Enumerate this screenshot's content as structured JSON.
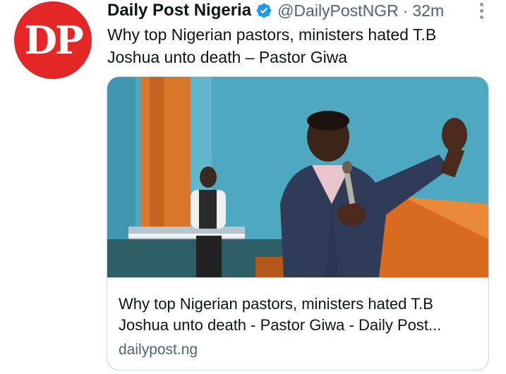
{
  "tweet": {
    "avatar_text": "DP",
    "display_name": "Daily Post Nigeria",
    "handle": "@DailyPostNGR",
    "separator": "·",
    "time": "32m",
    "text": "Why top Nigerian pastors, ministers hated T.B Joshua unto death – Pastor Giwa",
    "verified_icon": "verified-badge-icon",
    "more_icon": "more-vertical-icon"
  },
  "card": {
    "title_line1": "Why top Nigerian pastors, ministers hated T.B",
    "title_line2": "Joshua unto death - Pastor Giwa - Daily Post...",
    "domain": "dailypost.ng",
    "image_alt_icon": "preacher-photo"
  },
  "colors": {
    "brand_red": "#e32626",
    "verified_blue": "#1d9bf0",
    "text_primary": "#0f1419",
    "text_secondary": "#536471",
    "border": "#cfd9de"
  }
}
